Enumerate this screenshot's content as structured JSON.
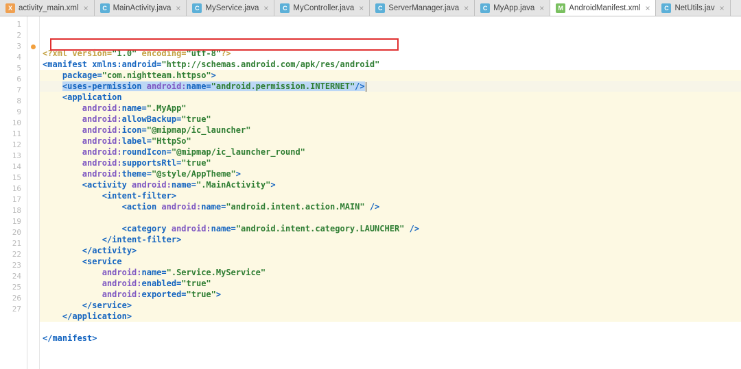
{
  "tabs": [
    {
      "name": "activity_main.xml",
      "icon": "xml"
    },
    {
      "name": "MainActivity.java",
      "icon": "java"
    },
    {
      "name": "MyService.java",
      "icon": "java"
    },
    {
      "name": "MyController.java",
      "icon": "java"
    },
    {
      "name": "ServerManager.java",
      "icon": "java"
    },
    {
      "name": "MyApp.java",
      "icon": "java"
    },
    {
      "name": "AndroidManifest.xml",
      "icon": "manifest",
      "active": true
    },
    {
      "name": "NetUtils.jav",
      "icon": "java"
    }
  ],
  "iconLabels": {
    "xml": "X",
    "java": "C",
    "manifest": "M"
  },
  "lineNumbers": [
    "1",
    "2",
    "3",
    "4",
    "5",
    "6",
    "7",
    "8",
    "9",
    "10",
    "11",
    "12",
    "13",
    "14",
    "15",
    "16",
    "17",
    "18",
    "19",
    "20",
    "21",
    "22",
    "23",
    "24",
    "25",
    "26",
    "27"
  ],
  "gutterMark": {
    "line": 3
  },
  "code": {
    "xmlDecl": {
      "text": "<?xml version=",
      "v": "\"1.0\"",
      "enc": " encoding=",
      "e": "\"utf-8\"",
      "end": "?>"
    },
    "manifestOpen": {
      "tag": "<manifest ",
      "attr": "xmlns:android=",
      "val": "\"http://schemas.android.com/apk/res/android\""
    },
    "package": {
      "attr": "package=",
      "val": "\"com.nightteam.httpso\"",
      "end": ">"
    },
    "usesPerm": {
      "tag": "<uses-permission ",
      "ns": "android:",
      "attr": "name=",
      "val": "\"android.permission.INTERNET\"",
      "end": "/>"
    },
    "application": {
      "tag": "<application"
    },
    "appAttrs": [
      {
        "ns": "android:",
        "name": "name=",
        "val": "\".MyApp\""
      },
      {
        "ns": "android:",
        "name": "allowBackup=",
        "val": "\"true\""
      },
      {
        "ns": "android:",
        "name": "icon=",
        "val": "\"@mipmap/ic_launcher\""
      },
      {
        "ns": "android:",
        "name": "label=",
        "val": "\"HttpSo\""
      },
      {
        "ns": "android:",
        "name": "roundIcon=",
        "val": "\"@mipmap/ic_launcher_round\""
      },
      {
        "ns": "android:",
        "name": "supportsRtl=",
        "val": "\"true\""
      },
      {
        "ns": "android:",
        "name": "theme=",
        "val": "\"@style/AppTheme\"",
        "end": ">"
      }
    ],
    "activityOpen": {
      "tag": "<activity ",
      "ns": "android:",
      "attr": "name=",
      "val": "\".MainActivity\"",
      "end": ">"
    },
    "intentFilterOpen": "<intent-filter>",
    "action": {
      "tag": "<action ",
      "ns": "android:",
      "attr": "name=",
      "val": "\"android.intent.action.MAIN\"",
      "end": " />"
    },
    "category": {
      "tag": "<category ",
      "ns": "android:",
      "attr": "name=",
      "val": "\"android.intent.category.LAUNCHER\"",
      "end": " />"
    },
    "intentFilterClose": "</intent-filter>",
    "activityClose": "</activity>",
    "serviceOpen": "<service",
    "serviceAttrs": [
      {
        "ns": "android:",
        "name": "name=",
        "val": "\".Service.MyService\""
      },
      {
        "ns": "android:",
        "name": "enabled=",
        "val": "\"true\""
      },
      {
        "ns": "android:",
        "name": "exported=",
        "val": "\"true\"",
        "end": ">"
      }
    ],
    "serviceClose": "</service>",
    "applicationClose": "</application>",
    "blank": "",
    "manifestClose": "</manifest>"
  }
}
